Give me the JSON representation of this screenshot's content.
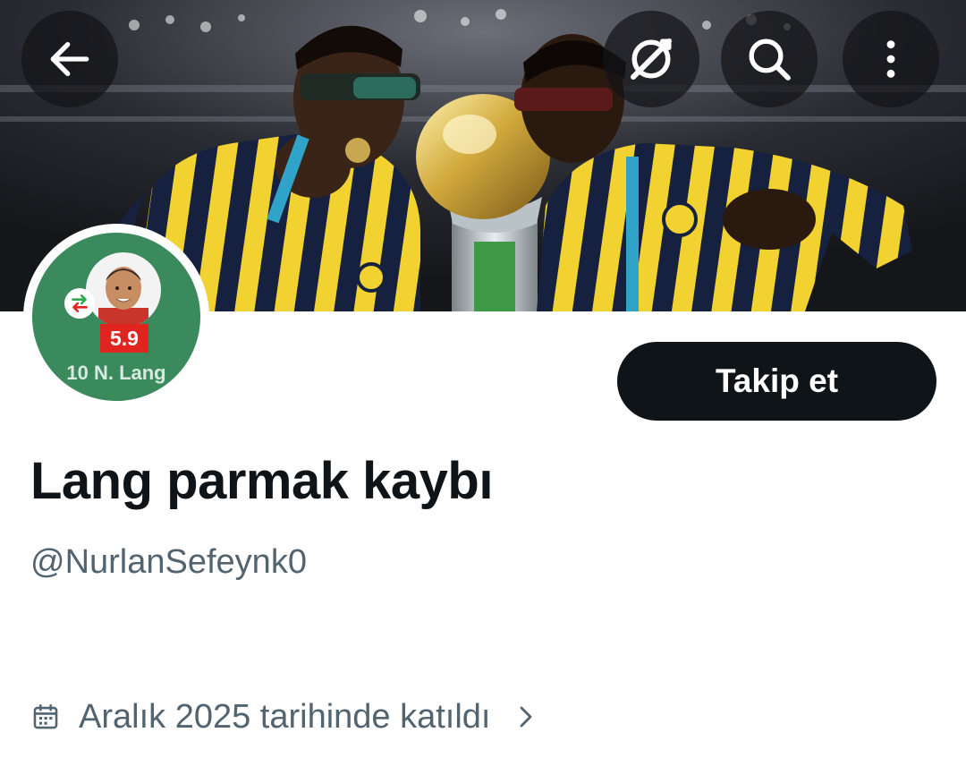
{
  "header": {
    "back_icon": "arrow-left-icon",
    "grok_icon": "grok-icon",
    "search_icon": "search-icon",
    "more_icon": "more-vertical-icon"
  },
  "banner": {
    "description_colors": {
      "jersey_yellow": "#f2d230",
      "jersey_navy": "#16213f"
    }
  },
  "avatar": {
    "rating": "5.9",
    "player_label": "10 N. Lang",
    "rating_color": "#e0241f",
    "background_color": "#3b8a5e"
  },
  "profile": {
    "follow_label": "Takip et",
    "display_name": "Lang parmak kaybı",
    "handle": "@NurlanSefeynk0",
    "joined_text": "Aralık 2025 tarihinde katıldı",
    "calendar_icon": "calendar-icon",
    "chevron_icon": "chevron-right-icon"
  },
  "colors": {
    "primary_text": "#0f1419",
    "secondary_text": "#536471",
    "button_bg": "#0f1419"
  }
}
